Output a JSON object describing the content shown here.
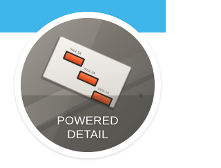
{
  "badge": {
    "caption_line1": "POWERED",
    "caption_line2": "DETAIL",
    "image_subject": "usb-charging-ports-photo"
  },
  "colors": {
    "band": "#3fb6ea",
    "ring": "#ffffff",
    "caption": "#ffffff",
    "port_accent": "#f05a2c"
  },
  "ports": {
    "labels": [
      "5V/2.1A",
      "5V/2.1A",
      "5V/2.1A"
    ]
  }
}
